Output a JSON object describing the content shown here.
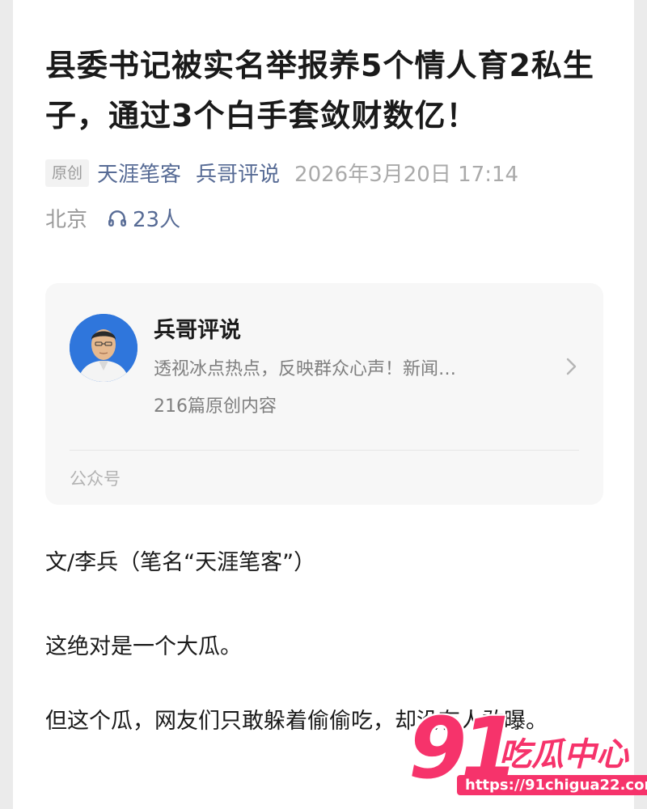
{
  "article": {
    "title": "县委书记被实名举报养5个情人育2私生子，通过3个白手套敛财数亿！",
    "original_tag": "原创",
    "author": "天涯笔客",
    "account": "兵哥评说",
    "date": "2026年3月20日 17:14",
    "location": "北京",
    "listen_count": "23人",
    "listen_icon": "headphones-icon"
  },
  "profile_card": {
    "name": "兵哥评说",
    "description": "透视冰点热点，反映群众心声！新闻…",
    "count": "216篇原创内容",
    "type_label": "公众号",
    "chevron_icon": "chevron-right-icon"
  },
  "body": {
    "p1": "文/李兵（笔名“天涯笔客”）",
    "p2": "这绝对是一个大瓜。",
    "p3": "但这个瓜，网友们只敢躲着偷偷吃，却没有人敢曝。"
  },
  "watermark": {
    "logo_number": "91",
    "logo_text": "吃瓜中心",
    "url": "https://91chigua22.com",
    "color": "#f6336b"
  },
  "colors": {
    "link": "#576b95",
    "meta_gray": "#9a9a9a",
    "card_bg": "#f7f7f7"
  }
}
